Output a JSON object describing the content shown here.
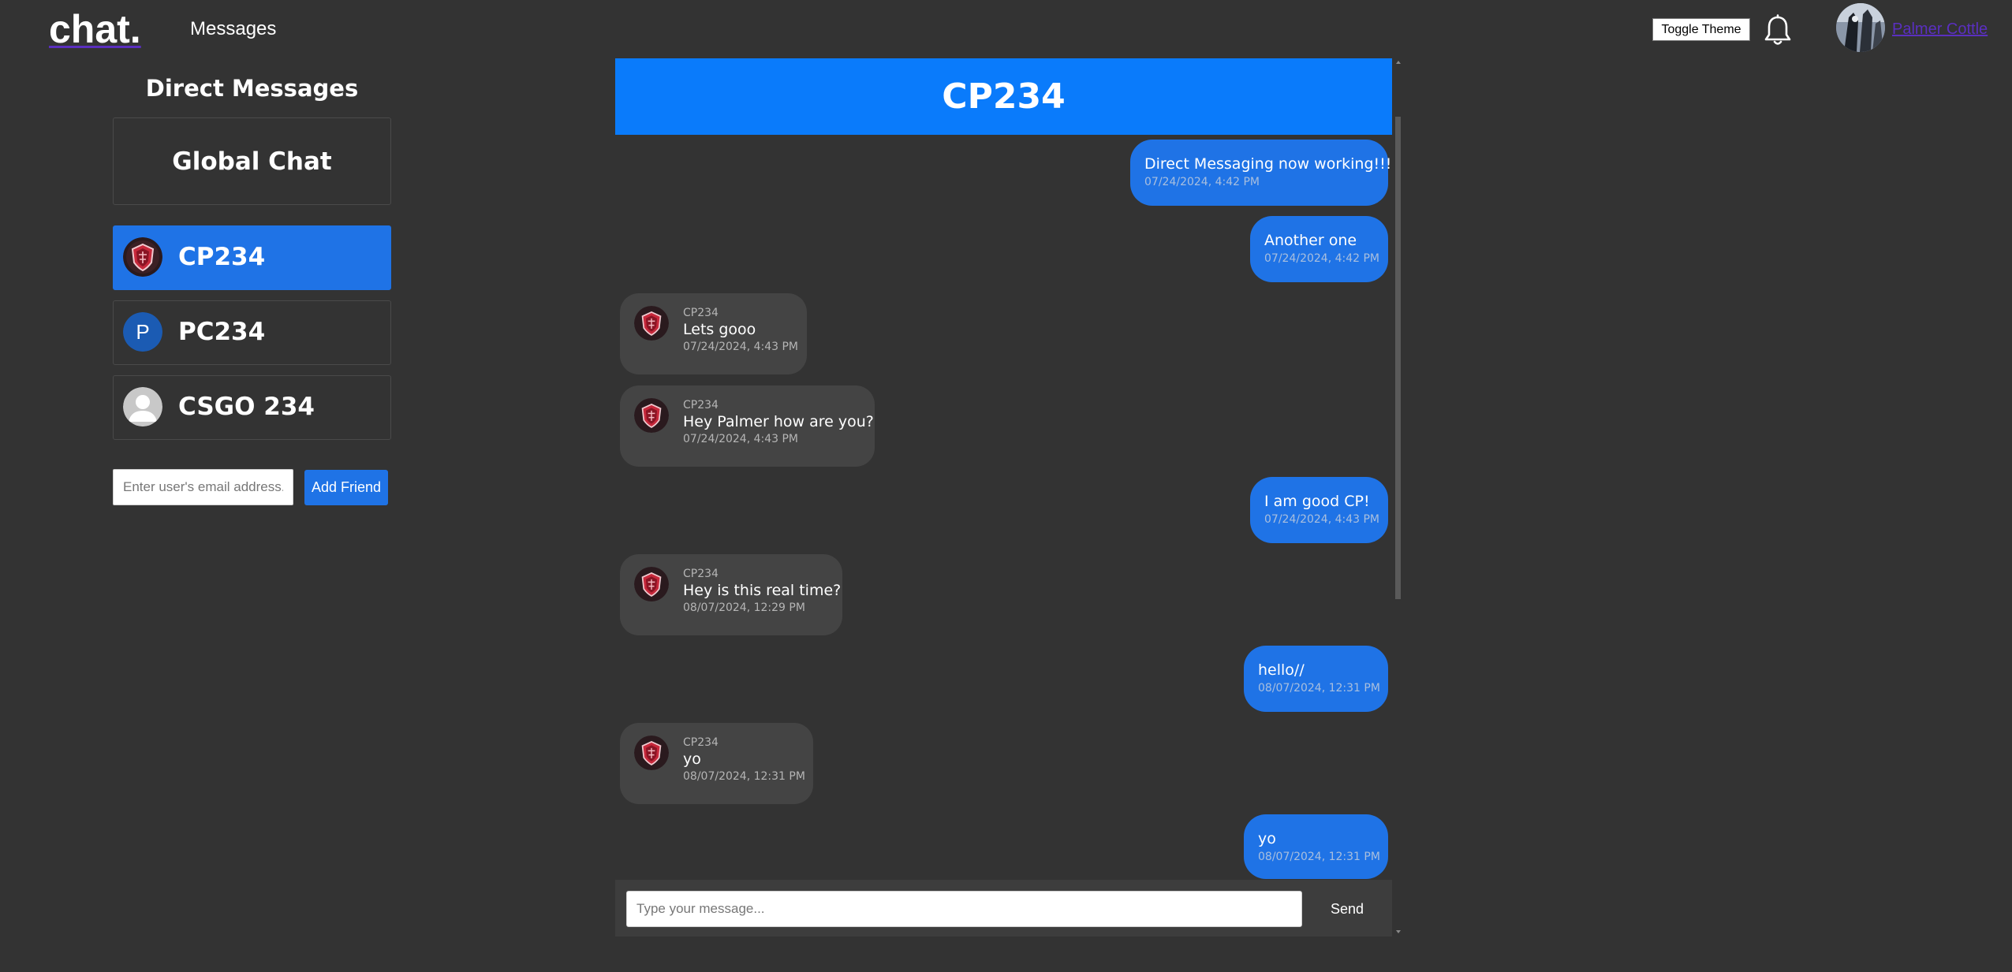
{
  "navbar": {
    "logo_text": "chat.",
    "messages_link": "Messages",
    "toggle_theme_label": "Toggle Theme",
    "bell_icon": "bell-icon",
    "profile_name": "Palmer Cottle"
  },
  "sidebar": {
    "title": "Direct Messages",
    "global_chat_label": "Global Chat",
    "friends": [
      {
        "name": "CP234",
        "avatar": "shield-emblem",
        "active": true
      },
      {
        "name": "PC234",
        "avatar_letter": "P",
        "active": false
      },
      {
        "name": "CSGO 234",
        "avatar": "default-user",
        "active": false
      }
    ],
    "email_placeholder": "Enter user's email address...",
    "add_friend_label": "Add Friend"
  },
  "chat": {
    "title": "CP234",
    "messages": [
      {
        "direction": "out",
        "text": "Direct Messaging now working!!!",
        "time": "07/24/2024, 4:42 PM"
      },
      {
        "direction": "out",
        "text": "Another one",
        "time": "07/24/2024, 4:42 PM"
      },
      {
        "direction": "in",
        "sender": "CP234",
        "text": "Lets gooo",
        "time": "07/24/2024, 4:43 PM"
      },
      {
        "direction": "in",
        "sender": "CP234",
        "text": "Hey Palmer how are you?",
        "time": "07/24/2024, 4:43 PM"
      },
      {
        "direction": "out",
        "text": "I am good CP!",
        "time": "07/24/2024, 4:43 PM"
      },
      {
        "direction": "in",
        "sender": "CP234",
        "text": "Hey is this real time?",
        "time": "08/07/2024, 12:29 PM"
      },
      {
        "direction": "out",
        "text": "hello//",
        "time": "08/07/2024, 12:31 PM"
      },
      {
        "direction": "in",
        "sender": "CP234",
        "text": "yo",
        "time": "08/07/2024, 12:31 PM"
      },
      {
        "direction": "out",
        "text": "yo",
        "time": "08/07/2024, 12:31 PM"
      }
    ],
    "input_placeholder": "Type your message...",
    "send_label": "Send"
  },
  "colors": {
    "background": "#333333",
    "accent": "#1f73e6",
    "header_blue": "#0a7bfb",
    "incoming_bubble": "#444444",
    "profile_link": "#5a2fc0"
  }
}
